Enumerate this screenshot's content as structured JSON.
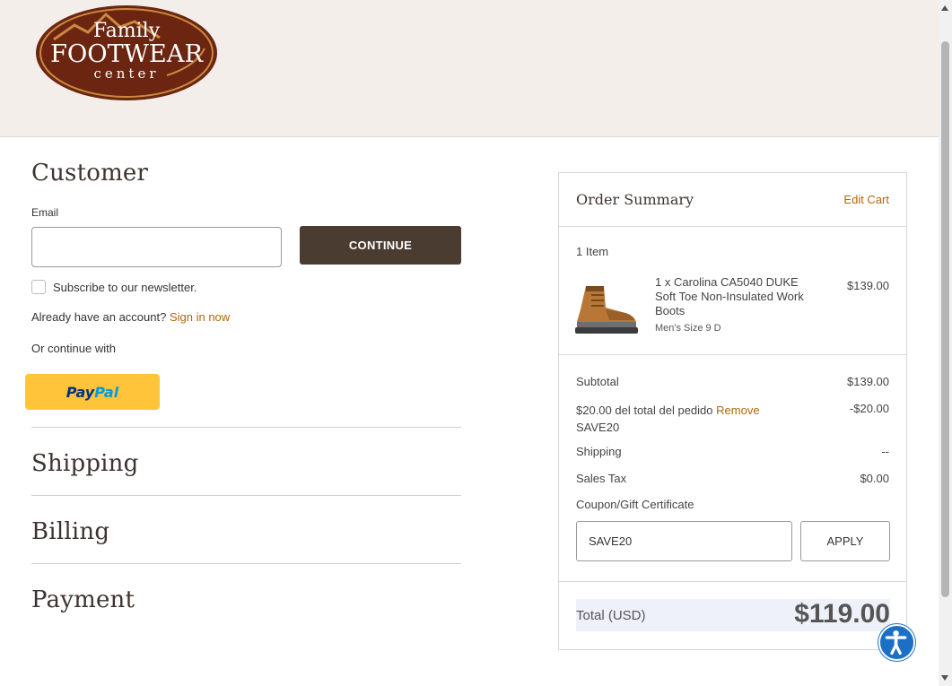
{
  "brand": {
    "logo_line1": "Family",
    "logo_line2": "FOOTWEAR",
    "logo_line3": "center",
    "colors": {
      "header_bg": "#f3eeea",
      "accent": "#b0670f",
      "button_dark": "#4a3c30",
      "paypal_yellow": "#ffc439"
    }
  },
  "customer": {
    "title": "Customer",
    "email_label": "Email",
    "email_value": "",
    "continue_label": "CONTINUE",
    "newsletter_label": "Subscribe to our newsletter.",
    "account_prompt": "Already have an account?",
    "sign_in_label": "Sign in now",
    "or_continue": "Or continue with",
    "paypal_part1": "Pay",
    "paypal_part2": "Pal"
  },
  "steps": {
    "shipping": "Shipping",
    "billing": "Billing",
    "payment": "Payment"
  },
  "summary": {
    "title": "Order Summary",
    "edit_cart": "Edit Cart",
    "item_count": "1 Item",
    "item": {
      "name": "1 x Carolina CA5040 DUKE Soft Toe Non-Insulated Work Boots",
      "size": "Men's Size 9 D",
      "price": "$139.00",
      "image_icon": "work-boot-icon"
    },
    "subtotal_label": "Subtotal",
    "subtotal_value": "$139.00",
    "discount_label": "$20.00 del total del pedido",
    "discount_remove": "Remove",
    "discount_code": "SAVE20",
    "discount_value": "-$20.00",
    "shipping_label": "Shipping",
    "shipping_value": "--",
    "tax_label": "Sales Tax",
    "tax_value": "$0.00",
    "coupon_link": "Coupon/Gift Certificate",
    "coupon_value": "SAVE20",
    "apply_label": "APPLY",
    "total_label": "Total (USD)",
    "total_value": "$119.00"
  },
  "accessibility_icon": "accessibility-icon"
}
